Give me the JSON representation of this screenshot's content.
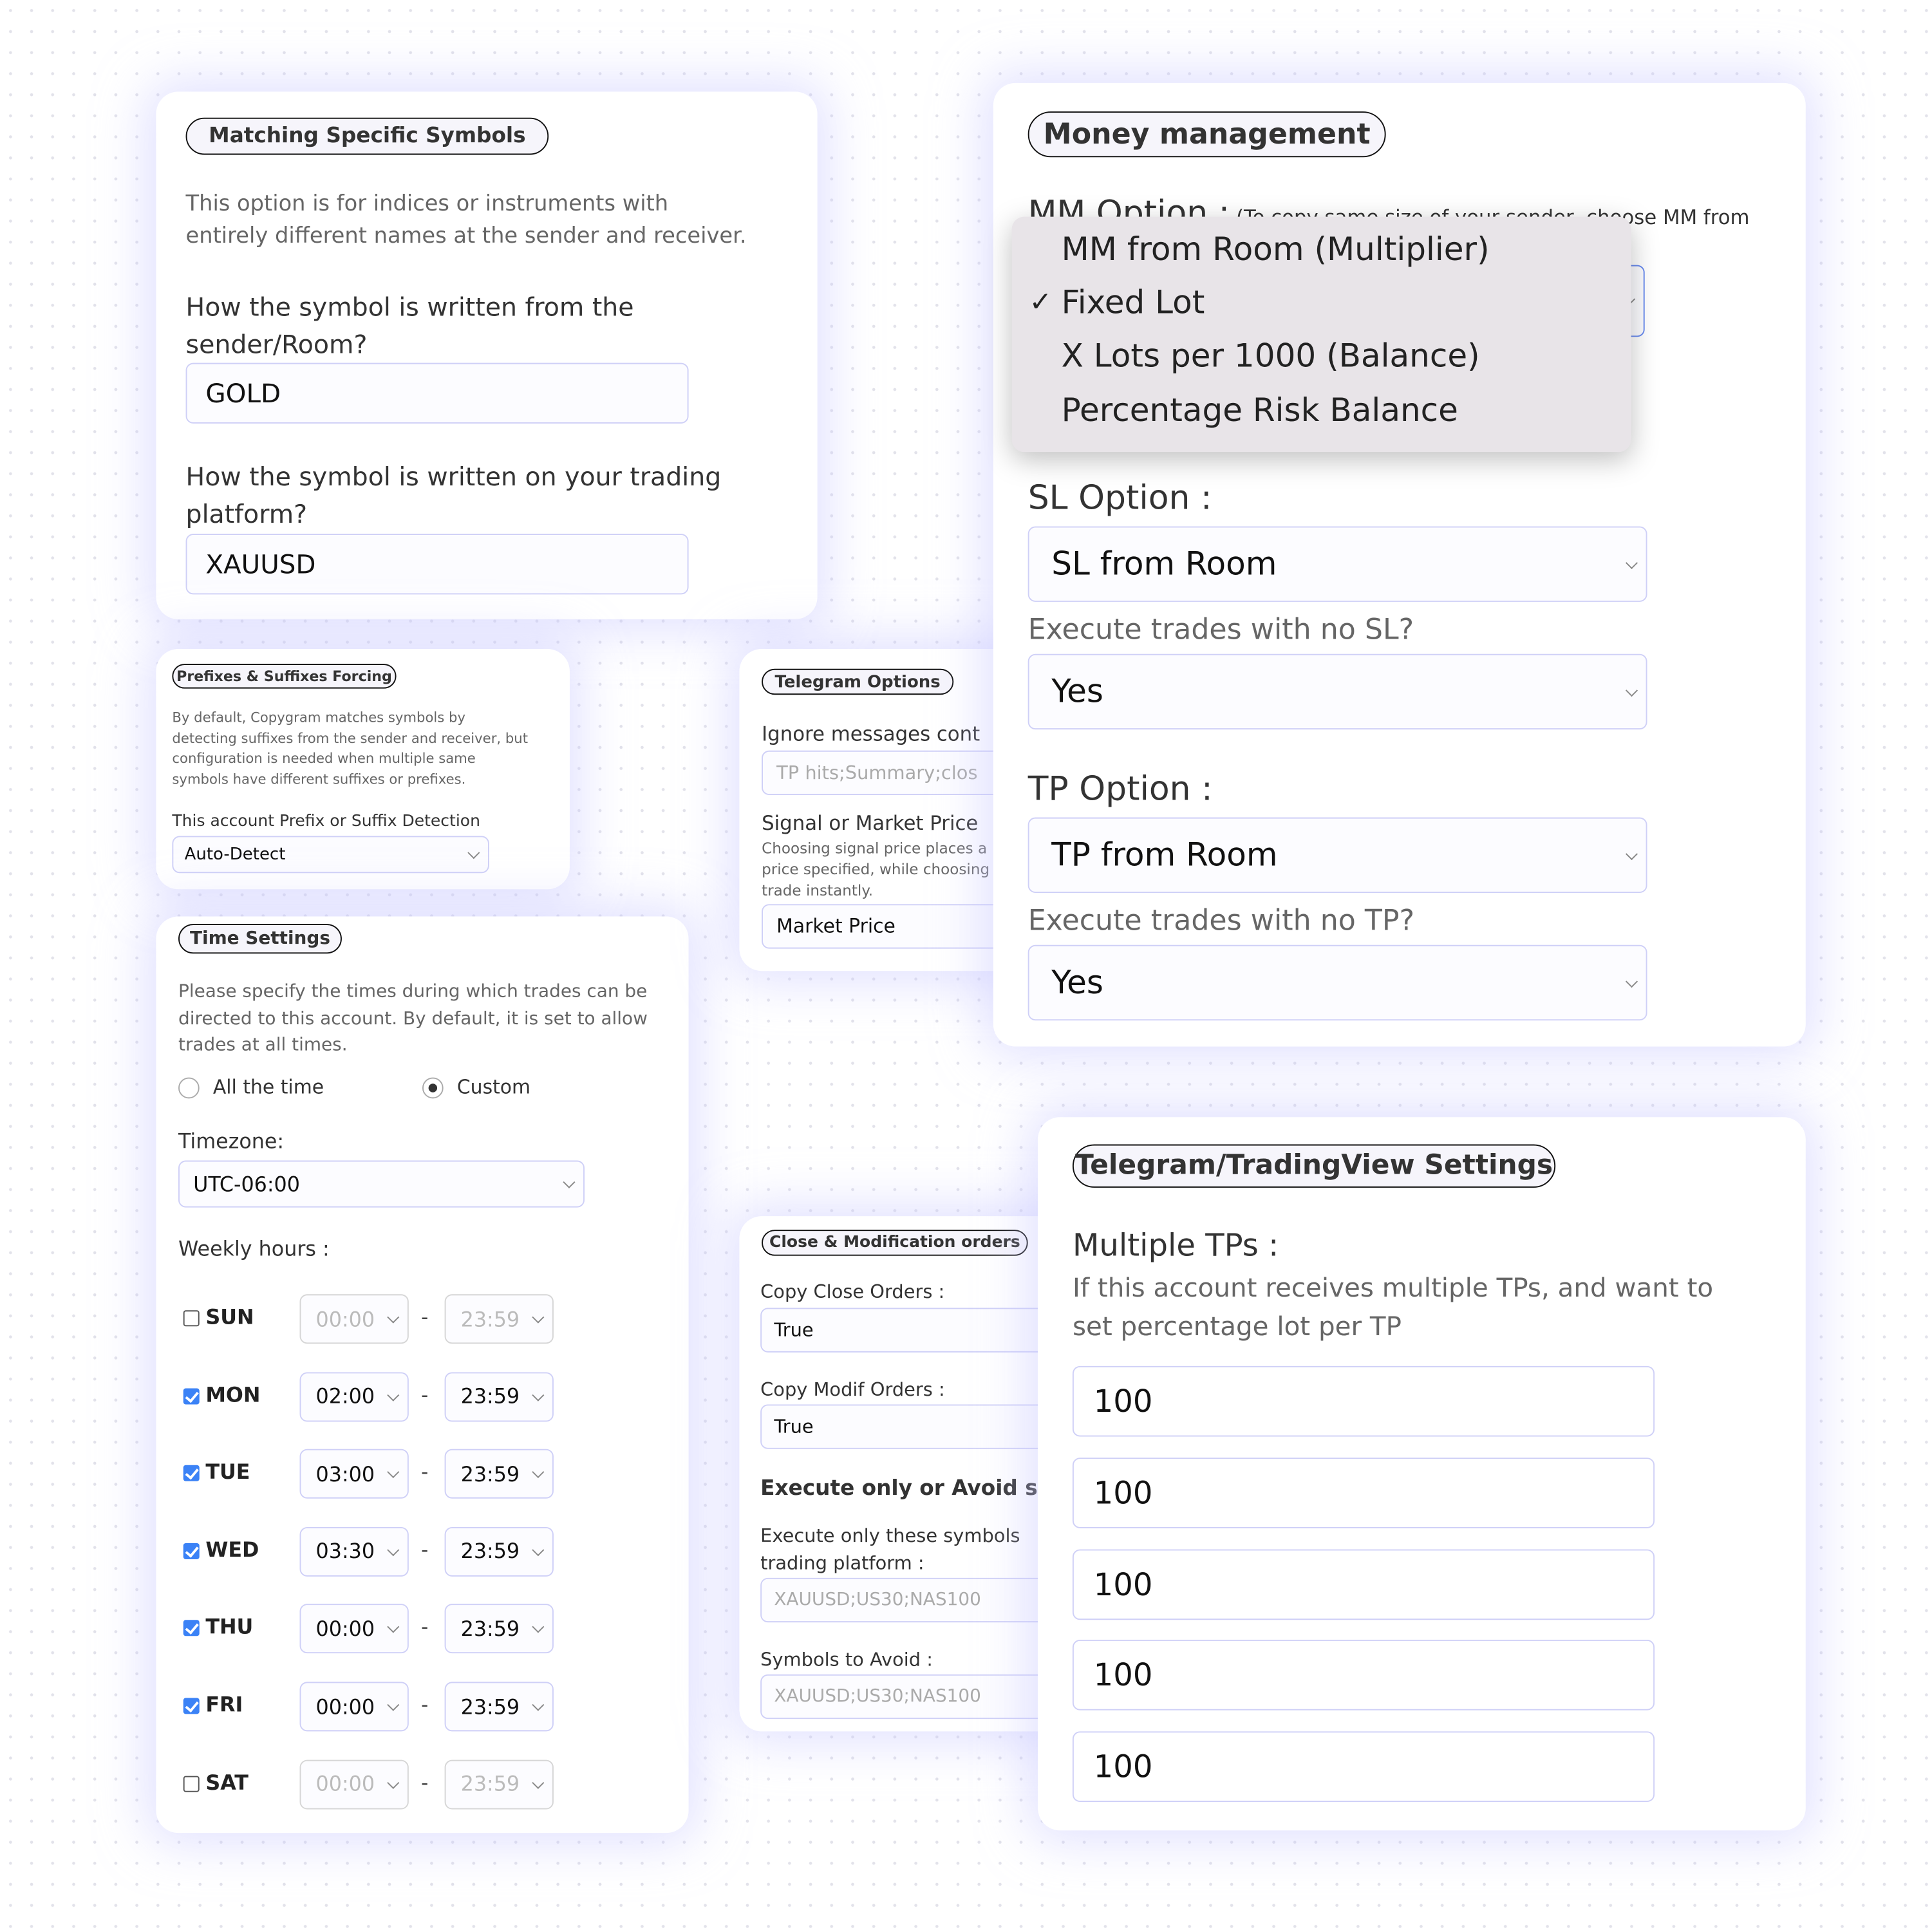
{
  "matching": {
    "title": "Matching Specific Symbols",
    "desc": [
      "This option is for indices or instruments with",
      "entirely different names at the sender and receiver."
    ],
    "q1": [
      "How the symbol is written from the",
      "sender/Room?"
    ],
    "v1": "GOLD",
    "q2": [
      "How the symbol is written on your trading",
      "platform?"
    ],
    "v2": "XAUUSD"
  },
  "prefix": {
    "title": "Prefixes & Suffixes Forcing",
    "desc": [
      "By default, Copygram matches symbols by",
      "detecting suffixes from the sender and receiver, but",
      "configuration is needed when multiple same",
      "symbols have different suffixes or prefixes."
    ],
    "label": "This account Prefix or Suffix Detection",
    "value": "Auto-Detect"
  },
  "time": {
    "title": "Time Settings",
    "desc": [
      "Please specify the times during which trades can be",
      "directed to this account. By default, it is set to allow",
      "trades at all times."
    ],
    "radio_all": "All the time",
    "radio_custom": "Custom",
    "selected": "Custom",
    "tz_label": "Timezone:",
    "tz_value": "UTC-06:00",
    "weekly_label": "Weekly hours :",
    "days": [
      {
        "day": "SUN",
        "checked": false,
        "from": "00:00",
        "to": "23:59"
      },
      {
        "day": "MON",
        "checked": true,
        "from": "02:00",
        "to": "23:59"
      },
      {
        "day": "TUE",
        "checked": true,
        "from": "03:00",
        "to": "23:59"
      },
      {
        "day": "WED",
        "checked": true,
        "from": "03:30",
        "to": "23:59"
      },
      {
        "day": "THU",
        "checked": true,
        "from": "00:00",
        "to": "23:59"
      },
      {
        "day": "FRI",
        "checked": true,
        "from": "00:00",
        "to": "23:59"
      },
      {
        "day": "SAT",
        "checked": false,
        "from": "00:00",
        "to": "23:59"
      }
    ],
    "dash": "-"
  },
  "telegram": {
    "title": "Telegram Options",
    "ignore_label": "Ignore messages cont",
    "ignore_placeholder": "TP hits;Summary;clos",
    "signal_label": "Signal or Market Price",
    "signal_desc": [
      "Choosing signal price places a",
      "price specified, while choosing",
      "trade instantly."
    ],
    "signal_value": "Market Price"
  },
  "close": {
    "title": "Close & Modification orders",
    "copy_close_label": "Copy Close Orders :",
    "copy_close_value": "True",
    "copy_modif_label": "Copy Modif Orders :",
    "copy_modif_value": "True",
    "exec_heading": "Execute only or Avoid so",
    "exec_only_label": [
      "Execute only these symbols",
      "trading platform :"
    ],
    "exec_only_placeholder": "XAUUSD;US30;NAS100",
    "avoid_label": "Symbols to Avoid :",
    "avoid_placeholder": "XAUUSD;US30;NAS100"
  },
  "money": {
    "title": "Money management",
    "mm_label": "MM Option :",
    "mm_note": "(To copy same size of your sender, choose MM from",
    "mm_options": [
      "MM from Room (Multiplier)",
      "Fixed Lot",
      "X Lots per 1000 (Balance)",
      "Percentage Risk Balance"
    ],
    "mm_selected": "Fixed Lot",
    "check": "✓",
    "sl_label": "SL Option :",
    "sl_value": "SL from Room",
    "no_sl_label": "Execute trades with no SL?",
    "no_sl_value": "Yes",
    "tp_label": "TP Option :",
    "tp_value": "TP from Room",
    "no_tp_label": "Execute trades with no TP?",
    "no_tp_value": "Yes"
  },
  "tv": {
    "title": "Telegram/TradingView Settings",
    "multi_label": "Multiple TPs :",
    "multi_desc": [
      "If this account receives multiple TPs, and want to",
      "set percentage lot per TP"
    ],
    "tps": [
      "100",
      "100",
      "100",
      "100",
      "100"
    ]
  },
  "colors": {
    "accent": "#3b82f6",
    "border": "#cfd0f7",
    "glow": "#c8c8ff",
    "dropdown": "#e8e4e8"
  }
}
